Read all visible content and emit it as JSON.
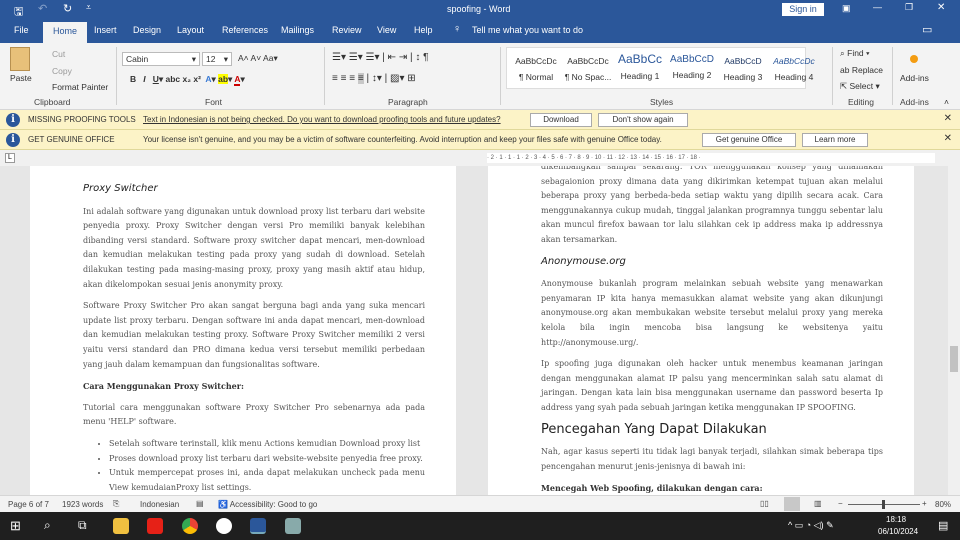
{
  "title_bar": {
    "title": "spoofing - Word",
    "sign_in": "Sign in"
  },
  "tabs": [
    "File",
    "Home",
    "Insert",
    "Design",
    "Layout",
    "References",
    "Mailings",
    "Review",
    "View",
    "Help"
  ],
  "tell_me": "Tell me what you want to do",
  "ribbon": {
    "clipboard": {
      "paste": "Paste",
      "cut": "Cut",
      "copy": "Copy",
      "format_painter": "Format Painter",
      "label": "Clipboard"
    },
    "font": {
      "name": "Cabin",
      "size": "12",
      "label": "Font"
    },
    "paragraph": {
      "label": "Paragraph"
    },
    "styles": {
      "items": [
        {
          "preview": "AaBbCcDc",
          "name": "¶ Normal"
        },
        {
          "preview": "AaBbCcDc",
          "name": "¶ No Spac..."
        },
        {
          "preview": "AaBbCc",
          "name": "Heading 1"
        },
        {
          "preview": "AaBbCcD",
          "name": "Heading 2"
        },
        {
          "preview": "AaBbCcD",
          "name": "Heading 3"
        },
        {
          "preview": "AaBbCcDc",
          "name": "Heading 4"
        }
      ],
      "label": "Styles"
    },
    "editing": {
      "find": "Find",
      "replace": "Replace",
      "select": "Select",
      "label": "Editing"
    },
    "addins": {
      "button": "Add-ins",
      "label": "Add-ins"
    }
  },
  "bars": {
    "proofing": {
      "title": "MISSING PROOFING TOOLS",
      "message": "Text in Indonesian is not being checked. Do you want to download proofing tools and future updates?",
      "download": "Download",
      "dont_show": "Don't show again"
    },
    "genuine": {
      "title": "GET GENUINE OFFICE",
      "message": "Your license isn't genuine, and you may be a victim of software counterfeiting. Avoid interruption and keep your files safe with genuine Office today.",
      "get": "Get genuine Office",
      "learn": "Learn more"
    }
  },
  "ruler": "· 2 · 1 · 1 · 1 · 2 · 3 · 4 · 5 · 6 · 7 · 8 · 9 · 10 · 11 · 12 · 13 · 14 · 15 · 16 · 17 · 18 ·",
  "left_page": {
    "h_proxy": "Proxy Switcher",
    "p1": "Ini adalah software yang digunakan untuk download proxy list terbaru dari website penyedia proxy. Proxy Switcher dengan versi Pro memiliki banyak kelebihan dibanding versi standard. Software proxy switcher dapat mencari, men-download dan kemudian melakukan testing pada proxy yang sudah di download. Setelah dilakukan testing pada masing-masing proxy, proxy yang masih aktif atau hidup, akan dikelompokan sesuai jenis anonymity proxy.",
    "p2": "Software Proxy Switcher Pro akan sangat berguna bagi anda yang suka mencari update list proxy terbaru. Dengan software ini anda dapat mencari, men-download dan kemudian melakukan testing proxy. Software Proxy Switcher memiliki 2 versi yaitu versi standard dan PRO dimana kedua versi tersebut memiliki perbedaan yang jauh dalam kemampuan dan fungsionalitas software.",
    "h_cara": "Cara Menggunakan Proxy Switcher:",
    "p3": "Tutorial cara menggunakan software Proxy Switcher Pro sebenarnya ada pada menu 'HELP' software.",
    "bullets": [
      "Setelah software terinstall, klik menu Actions kemudian Download proxy list",
      "Proses download proxy list terbaru dari website-website penyedia free proxy.",
      "Untuk mempercepat proses ini, anda dapat melakukan uncheck pada menu View kemudaianProxy list settings."
    ]
  },
  "right_page": {
    "p0": "dikembangkan sampai sekarang. TOR menggunakan konsep yang dinamakan sebagaionion proxy dimana data yang dikirimkan ketempat tujuan akan melalui beberapa proxy yang berbeda-beda setiap waktu yang dipilih secara acak. Cara menggunakannya cukup mudah, tinggal jalankan programnya tunggu sebentar lalu akan muncul firefox bawaan tor lalu silahkan cek ip address maka ip addressnya akan tersamarkan.",
    "h_anon": "Anonymouse.org",
    "p1": "Anonymouse bukanlah program melainkan sebuah website yang menawarkan penyamaran IP kita hanya memasukkan alamat website yang akan dikunjungi anonymouse.org akan membukakan website tersebut melalui proxy yang mereka kelola bila ingin mencoba bisa langsung ke websitenya yaitu http://anonymouse.urg/.",
    "p2": "Ip spoofing juga digunakan oleh hacker untuk menembus keamanan jaringan dengan menggunakan alamat IP palsu yang mencerminkan salah satu alamat di jaringan. Dengan kata lain bisa menggunakan username dan password beserta Ip address yang syah pada sebuah jaringan ketika menggunakan IP SPOOFING.",
    "h_pencegahan": "Pencegahan Yang Dapat Dilakukan",
    "p3": "Nah, agar kasus seperti itu tidak lagi banyak terjadi, silahkan simak beberapa tips pencengahan menurut jenis-jenisnya di bawah ini:",
    "h_web": "Mencegah Web Spoofing, dilakukan dengan cara:"
  },
  "status": {
    "page": "Page 6 of 7",
    "words": "1923 words",
    "language": "Indonesian",
    "accessibility": "Accessibility: Good to go",
    "zoom": "80%"
  },
  "taskbar": {
    "time": "18:18",
    "date": "06/10/2024"
  }
}
